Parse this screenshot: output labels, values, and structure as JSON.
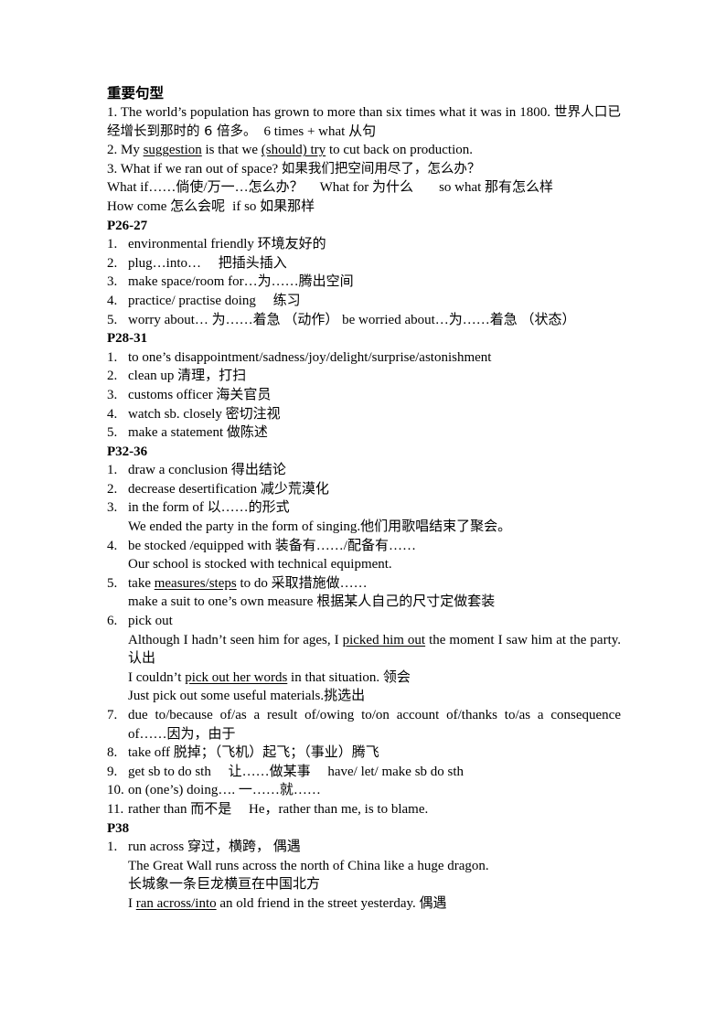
{
  "document": {
    "title_cn": "重要句型",
    "intro": {
      "item1": {
        "text_en": "1. The world’s population has grown to more than six times what it was in 1800.",
        "text_cn": "世界人口已经增长到那时的 6 倍多。",
        "note": "6 times + what 从句"
      },
      "item2": {
        "prefix": "2. My ",
        "u1": "suggestion",
        "mid": " is that we ",
        "u2": "(should) try",
        "suffix": " to cut back on production."
      },
      "item3": {
        "text_en": "3. What if we ran out of space?",
        "text_cn": "如果我们把空间用尽了，怎么办？"
      },
      "line4": {
        "a": "What if……倘使/万一…怎么办？",
        "b": "What for 为什么",
        "c": "so what 那有怎么样"
      },
      "line5": {
        "a": "How come 怎么会呢",
        "b": "if so 如果那样"
      }
    },
    "sections": [
      {
        "heading": "P26-27",
        "items": [
          {
            "num": "1.",
            "text": "environmental friendly 环境友好的"
          },
          {
            "num": "2.",
            "text": "plug…into…  把插头插入"
          },
          {
            "num": "3.",
            "text": "make space/room for…为……腾出空间"
          },
          {
            "num": "4.",
            "text": "practice/ practise doing  练习"
          },
          {
            "num": "5.",
            "text": "worry about… 为……着急 （动作） be worried about…为……着急 （状态）"
          }
        ]
      },
      {
        "heading": "P28-31",
        "items": [
          {
            "num": "1.",
            "text": "to one’s disappointment/sadness/joy/delight/surprise/astonishment"
          },
          {
            "num": "2.",
            "text": "clean up 清理，打扫"
          },
          {
            "num": "3.",
            "text": "customs officer 海关官员"
          },
          {
            "num": "4.",
            "text": "watch sb. closely 密切注视"
          },
          {
            "num": "5.",
            "text": "make a statement  做陈述"
          }
        ]
      },
      {
        "heading": "P32-36",
        "items": [
          {
            "num": "1.",
            "text": "draw a conclusion 得出结论"
          },
          {
            "num": "2.",
            "text": "decrease desertification 减少荒漠化"
          },
          {
            "num": "3.",
            "text": "in the form of 以……的形式"
          },
          {
            "sub": true,
            "text": "We ended the party in the form of singing.他们用歌唱结束了聚会。"
          },
          {
            "num": "4.",
            "text": "be stocked /equipped with 装备有……/配备有……"
          },
          {
            "sub": true,
            "text": "Our school is stocked with technical equipment."
          },
          {
            "num": "5.",
            "text_parts": {
              "a": "take ",
              "u": "measures/steps",
              "b": " to do 采取措施做……"
            }
          },
          {
            "sub": true,
            "text": "make a suit to one’s own measure 根据某人自己的尺寸定做套装"
          },
          {
            "num": "6.",
            "text": "pick out"
          },
          {
            "sub": true,
            "justify": true,
            "text_parts": {
              "a": "Although I hadn’t seen him for ages, I ",
              "u": "picked him out",
              "b": " the moment I saw him at the party.认出"
            }
          },
          {
            "sub": true,
            "text_parts": {
              "a": "I couldn’t ",
              "u": "pick out her words",
              "b": " in that situation. 领会"
            }
          },
          {
            "sub": true,
            "text": "Just pick out some useful materials.挑选出"
          },
          {
            "num": "7.",
            "justify": true,
            "text": "due to/because of/as a result of/owing to/on account of/thanks to/as a consequence of……因为，由于"
          },
          {
            "num": "8.",
            "text": "take off 脱掉；（飞机）起飞；（事业）腾飞"
          },
          {
            "num": "9.",
            "text": "get sb to do sth  让……做某事  have/ let/ make sb do sth"
          },
          {
            "num": "10.",
            "text": "on (one’s) doing…. 一……就……"
          },
          {
            "num": "11.",
            "text": "rather than 而不是  He，rather than me, is to blame."
          }
        ]
      },
      {
        "heading": "P38",
        "items": [
          {
            "num": "1.",
            "text": "run across 穿过，横跨， 偶遇"
          },
          {
            "sub": true,
            "text": "The Great Wall runs across the north of China like a huge dragon."
          },
          {
            "sub": true,
            "text": "长城象一条巨龙横亘在中国北方"
          },
          {
            "sub": true,
            "text_parts": {
              "a": "I ",
              "u": "ran across/into",
              "b": " an old friend in the street yesterday. 偶遇"
            }
          }
        ]
      }
    ]
  }
}
